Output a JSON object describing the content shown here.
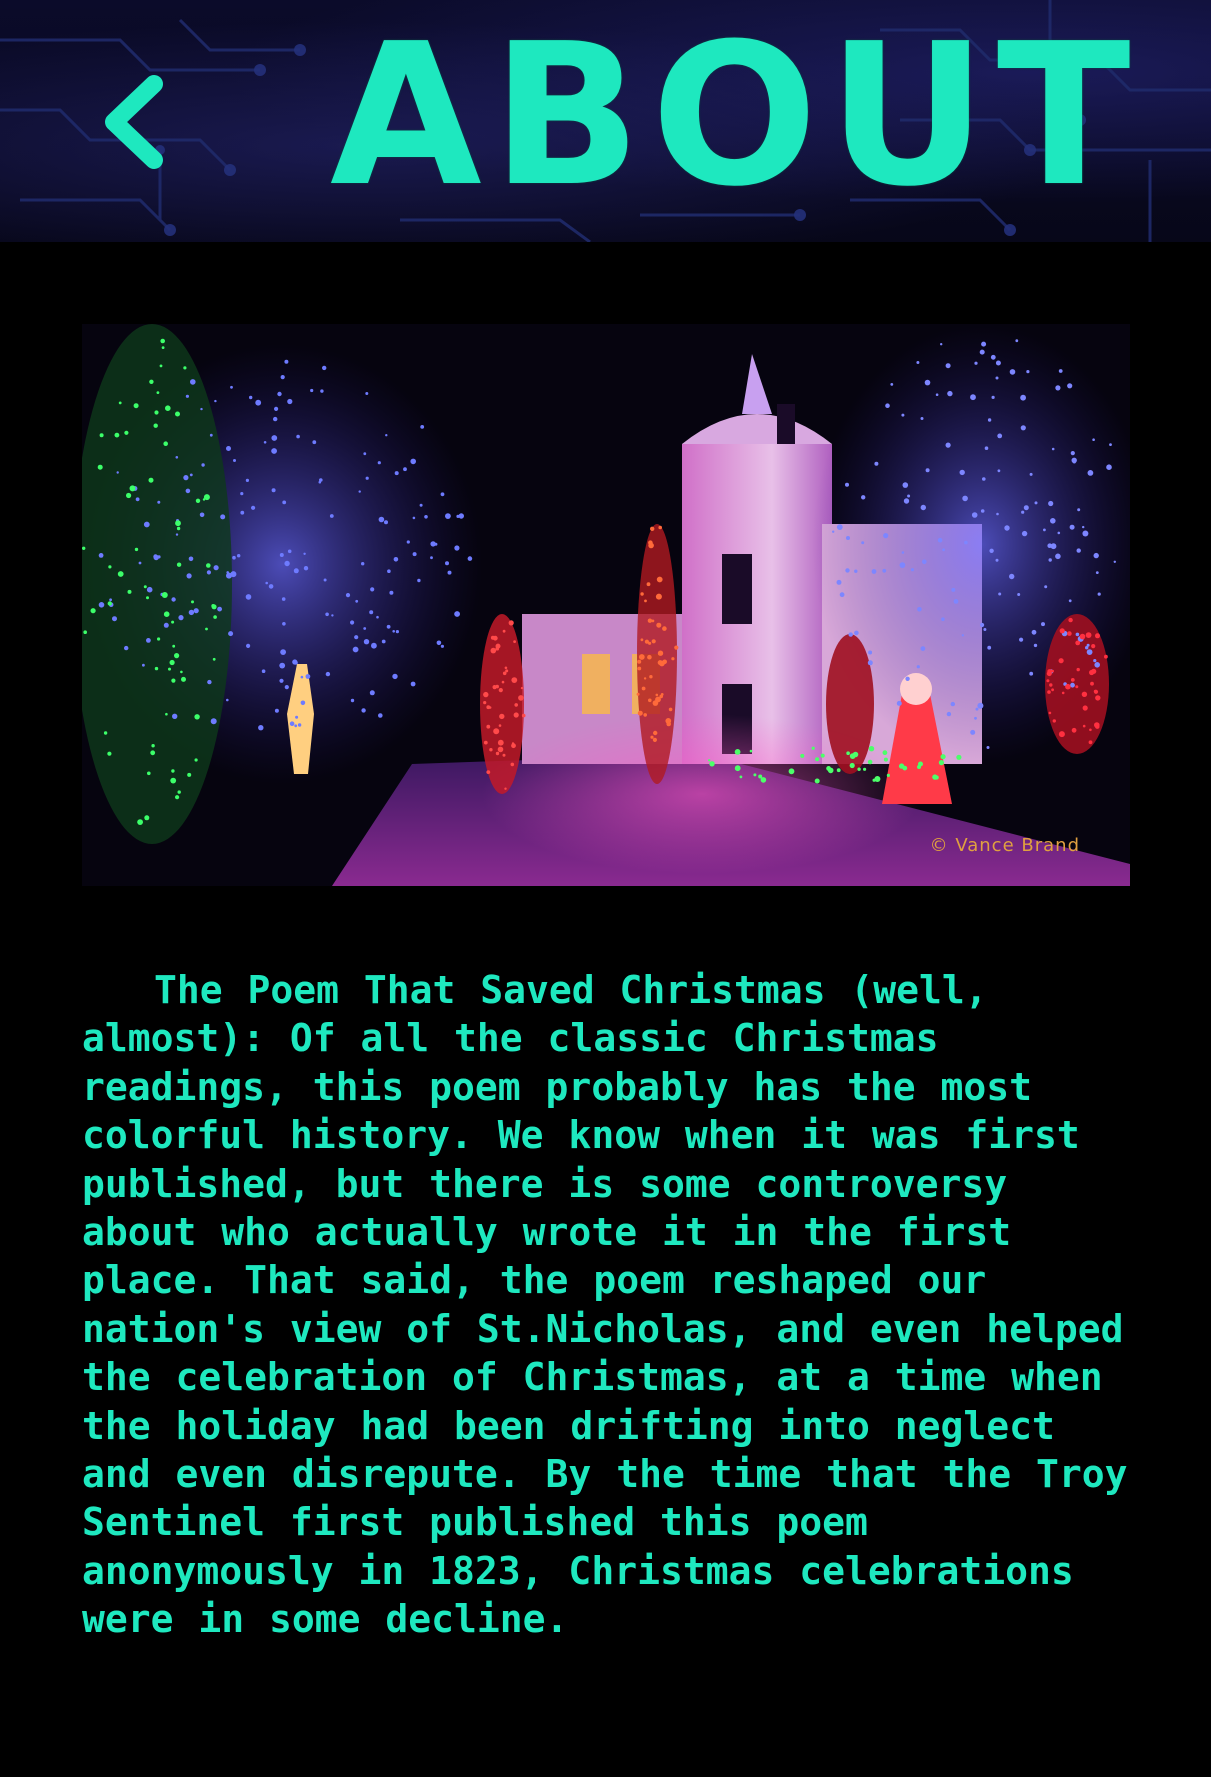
{
  "header": {
    "title": "ABOUT",
    "back_icon": "chevron-left-icon"
  },
  "colors": {
    "accent": "#1ee8bf",
    "background": "#000000",
    "header_background": "#0b0b2a"
  },
  "hero": {
    "photo_credit": "© Vance Brand"
  },
  "about": {
    "text": "The Poem That Saved Christmas (well, almost): Of all the classic Christmas readings, this poem probably has the most colorful history. We know when it was first published, but there is some controversy about who actually wrote it in the first place. That said, the poem reshaped our nation's view of St.Nicholas, and even helped the celebration of Christmas, at a time when the holiday had been drifting into neglect and even disrepute. By the time that the Troy Sentinel first published this poem anonymously in 1823, Christmas celebrations were in some decline."
  }
}
